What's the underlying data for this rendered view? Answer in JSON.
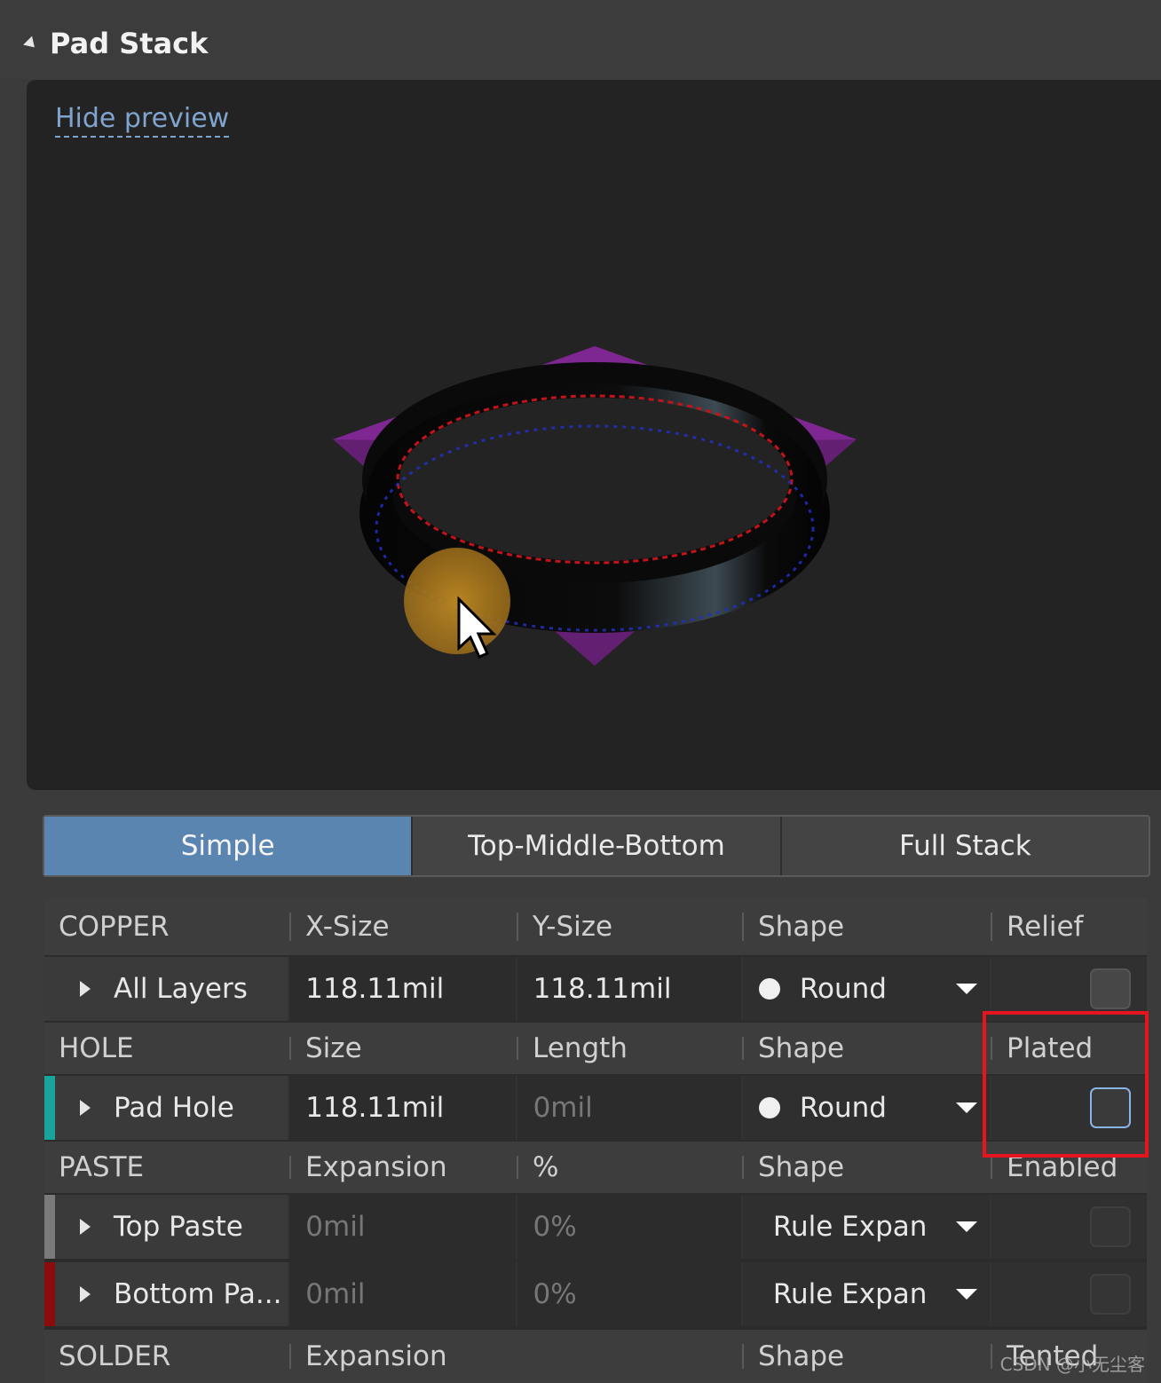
{
  "panel": {
    "title": "Pad Stack"
  },
  "preview": {
    "toggle_label": "Hide preview"
  },
  "mode_tabs": [
    {
      "label": "Simple",
      "active": true
    },
    {
      "label": "Top-Middle-Bottom",
      "active": false
    },
    {
      "label": "Full Stack",
      "active": false
    }
  ],
  "copper": {
    "headers": [
      "COPPER",
      "X-Size",
      "Y-Size",
      "Shape",
      "Relief"
    ],
    "row": {
      "name": "All Layers",
      "x_size": "118.11mil",
      "y_size": "118.11mil",
      "shape": "Round",
      "relief_checked": false
    }
  },
  "hole": {
    "headers": [
      "HOLE",
      "Size",
      "Length",
      "Shape",
      "Plated"
    ],
    "row": {
      "name": "Pad Hole",
      "size": "118.11mil",
      "length": "0mil",
      "shape": "Round",
      "plated_checked": false,
      "strip_color": "#1aa39a"
    }
  },
  "paste": {
    "headers": [
      "PASTE",
      "Expansion",
      "%",
      "Shape",
      "Enabled"
    ],
    "rows": [
      {
        "name": "Top Paste",
        "expansion": "0mil",
        "percent": "0%",
        "shape": "Rule Expan",
        "strip_color": "#7a7a7a"
      },
      {
        "name": "Bottom Pa...",
        "expansion": "0mil",
        "percent": "0%",
        "shape": "Rule Expan",
        "strip_color": "#8a0c0c"
      }
    ]
  },
  "solder": {
    "headers": [
      "SOLDER",
      "Expansion",
      "",
      "Shape",
      "Tented"
    ]
  },
  "watermark": "CSDN @小无尘客",
  "colors": {
    "accent_tab": "#5b85b1",
    "highlight_box": "#e5141e",
    "link": "#7fa4cf"
  }
}
